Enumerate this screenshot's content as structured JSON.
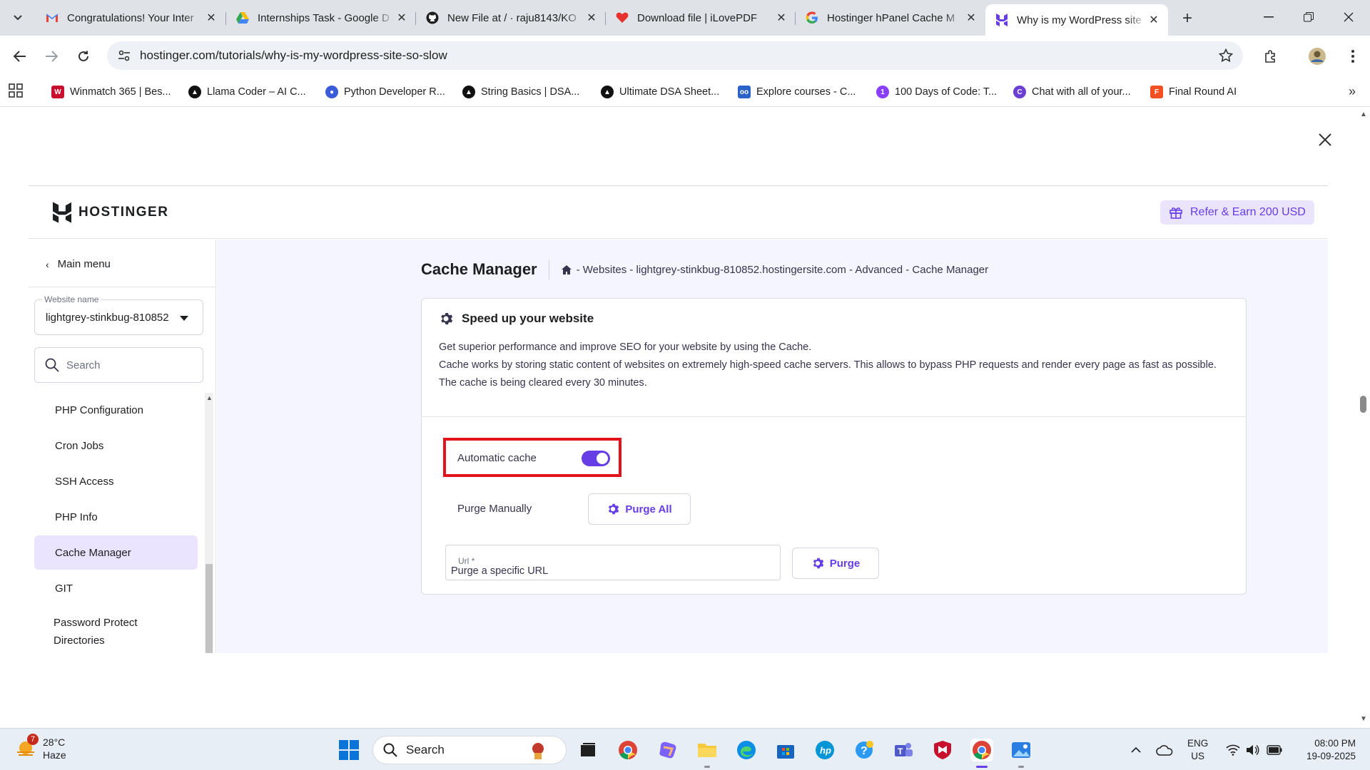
{
  "browser": {
    "tabs": [
      {
        "title": "Congratulations! Your Inter",
        "icon": "gmail-icon"
      },
      {
        "title": "Internships Task - Google D",
        "icon": "google-drive-icon"
      },
      {
        "title": "New File at / · raju8143/KO",
        "icon": "github-icon"
      },
      {
        "title": "Download file | iLovePDF",
        "icon": "ilovepdf-icon"
      },
      {
        "title": "Hostinger hPanel Cache M",
        "icon": "google-icon"
      },
      {
        "title": "Why is my WordPress site",
        "icon": "hostinger-icon",
        "active": true
      }
    ],
    "url": "hostinger.com/tutorials/why-is-my-wordpress-site-so-slow",
    "bookmarks": [
      {
        "label": "Winmatch 365 | Bes...",
        "color": "#c8102e"
      },
      {
        "label": "Llama Coder – AI C...",
        "color": "#111111"
      },
      {
        "label": "Python Developer R...",
        "color": "#3a5cd8"
      },
      {
        "label": "String Basics | DSA...",
        "color": "#111111"
      },
      {
        "label": "Ultimate DSA Sheet...",
        "color": "#111111"
      },
      {
        "label": "Explore courses - C...",
        "color": "#2a62c9"
      },
      {
        "label": "100 Days of Code: T...",
        "color": "#8a3ffc"
      },
      {
        "label": "Chat with all of your...",
        "color": "#6b3fd4"
      },
      {
        "label": "Final Round AI",
        "color": "#f25022"
      }
    ]
  },
  "hpanel": {
    "brand": "HOSTINGER",
    "refer_label": "Refer & Earn 200 USD",
    "sidebar": {
      "main_menu": "Main menu",
      "website_label": "Website name",
      "website_value": "lightgrey-stinkbug-810852",
      "search_placeholder": "Search",
      "items": [
        {
          "label": "PHP Configuration"
        },
        {
          "label": "Cron Jobs"
        },
        {
          "label": "SSH Access"
        },
        {
          "label": "PHP Info"
        },
        {
          "label": "Cache Manager",
          "active": true
        },
        {
          "label": "GIT"
        },
        {
          "label": "Password Protect Directories"
        }
      ]
    },
    "page_title": "Cache Manager",
    "breadcrumb": "- Websites - lightgrey-stinkbug-810852.hostingersite.com - Advanced - Cache Manager",
    "card": {
      "title": "Speed up your website",
      "desc_line1": "Get superior performance and improve SEO for your website by using the Cache.",
      "desc_line2": "Cache works by storing static content of websites on extremely high-speed cache servers. This allows to bypass PHP requests and render every page as fast as possible.",
      "desc_line3": "The cache is being cleared every 30 minutes.",
      "automatic_cache_label": "Automatic cache",
      "automatic_cache_on": true,
      "purge_manually_label": "Purge Manually",
      "purge_all_label": "Purge All",
      "url_label": "Url *",
      "url_placeholder": "Purge a specific URL",
      "purge_label": "Purge"
    },
    "accent_color": "#673de6"
  },
  "taskbar": {
    "weather_temp": "28°C",
    "weather_desc": "Haze",
    "weather_badge": "7",
    "search_label": "Search",
    "lang_top": "ENG",
    "lang_bottom": "US",
    "time": "08:00 PM",
    "date": "19-09-2025"
  }
}
